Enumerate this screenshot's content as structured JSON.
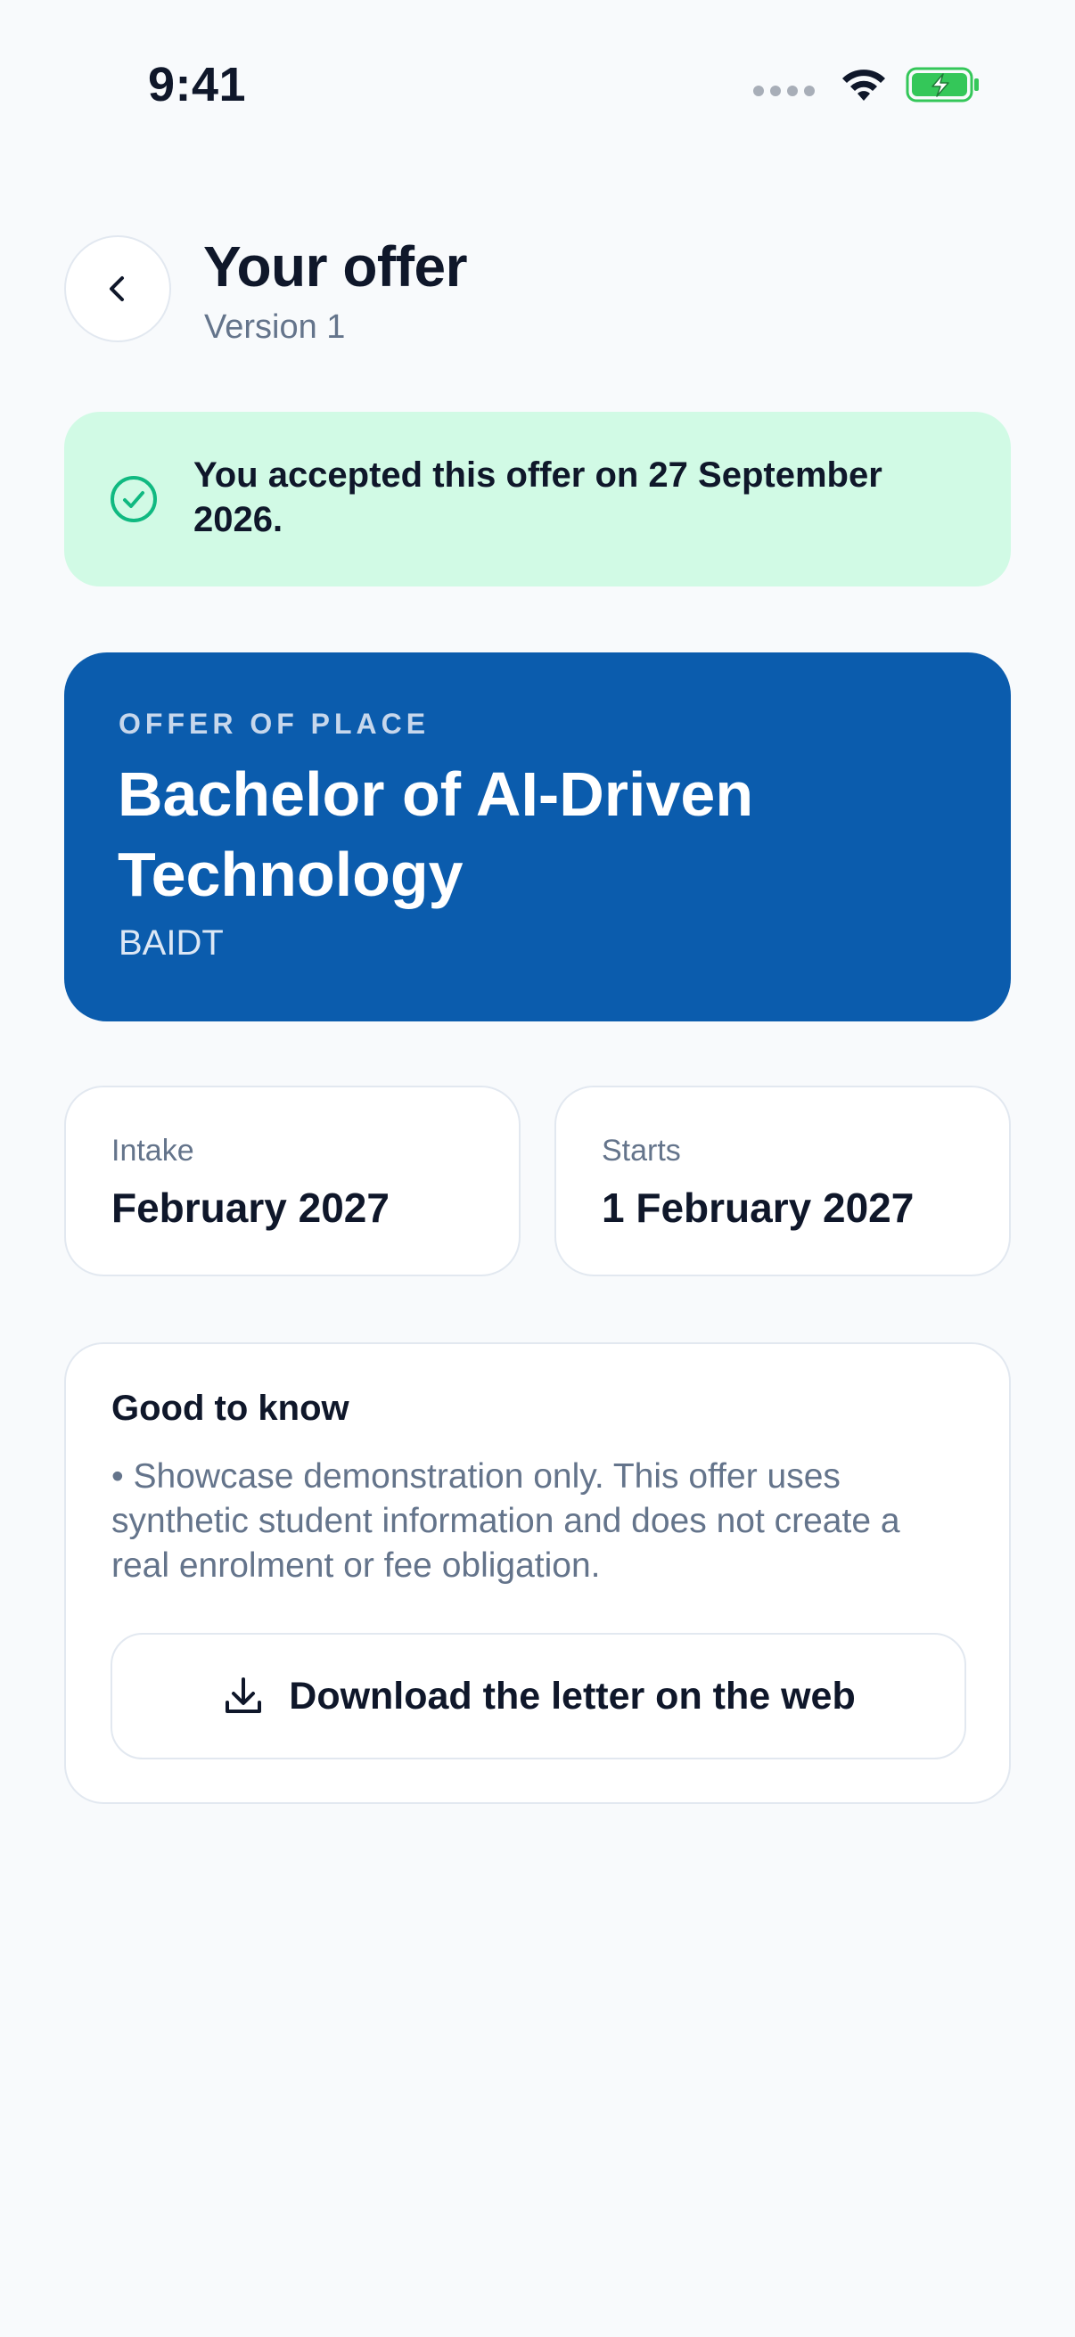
{
  "status_bar": {
    "time": "9:41",
    "icons": [
      "signal-dots-icon",
      "wifi-icon",
      "battery-charging-icon"
    ],
    "battery_color": "#34C759"
  },
  "header": {
    "back_icon": "chevron-left-icon",
    "title": "Your offer",
    "subtitle": "Version 1"
  },
  "accepted_banner": {
    "icon": "check-circle-icon",
    "text": "You accepted this offer on 27 September 2026.",
    "background": "#D1FAE5",
    "accent": "#10B981"
  },
  "offer_card": {
    "eyebrow": "OFFER OF PLACE",
    "title": "Bachelor of AI-Driven Technology",
    "code": "BAIDT",
    "background": "#0B5CAD"
  },
  "details": {
    "intake_label": "Intake",
    "intake_value": "February 2027",
    "starts_label": "Starts",
    "starts_value": "1 February 2027"
  },
  "good_to_know": {
    "title": "Good to know",
    "body": "• Showcase demonstration only. This offer uses synthetic student information and does not create a real enrolment or fee obligation.",
    "download_icon": "download-icon",
    "download_label": "Download the letter on the web"
  }
}
